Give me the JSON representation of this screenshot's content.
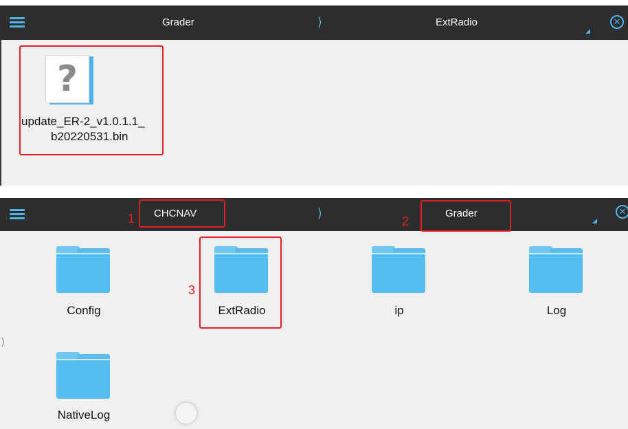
{
  "panel_top": {
    "breadcrumb": {
      "parent": "Grader",
      "separator": "⟩",
      "current": "ExtRadio"
    },
    "files": [
      {
        "name_line1": "update_ER-2_v1.0.1.1_",
        "name_line2": "b20220531.bin",
        "icon": "unknown-file-icon"
      }
    ]
  },
  "panel_bottom": {
    "breadcrumb": {
      "parent": "CHCNAV",
      "separator": "⟩",
      "current": "Grader"
    },
    "folders": [
      {
        "label": "Config"
      },
      {
        "label": "ExtRadio"
      },
      {
        "label": "ip"
      },
      {
        "label": "Log"
      },
      {
        "label": "NativeLog"
      }
    ],
    "annotations": [
      "1",
      "2",
      "3"
    ]
  },
  "icons": {
    "menu": "menu-icon",
    "close": "close-circle-icon",
    "folder": "folder-icon"
  },
  "colors": {
    "bar": "#2d2d2d",
    "accent": "#4fb3e8",
    "folder": "#56bdf0",
    "highlight": "#e02020",
    "background": "#f0f0f0"
  }
}
